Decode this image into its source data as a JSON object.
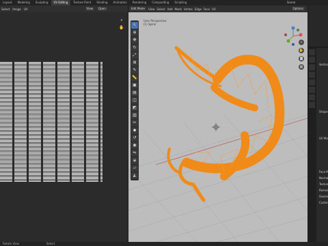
{
  "topbar": {
    "tabs": [
      "Layout",
      "Modeling",
      "Sculpting",
      "UV Editing",
      "Texture Paint",
      "Shading",
      "Animation",
      "Rendering",
      "Compositing",
      "Scripting"
    ],
    "active_tab": "UV Editing",
    "scene_label": "Scene"
  },
  "uv_editor": {
    "menu": [
      "Select",
      "Image",
      "UV"
    ],
    "view_label": "View",
    "open_label": "Open"
  },
  "viewport": {
    "mode": "Edit Mode",
    "menu": [
      "View",
      "Select",
      "Add",
      "Mesh",
      "Vertex",
      "Edge",
      "Face",
      "UV"
    ],
    "options_label": "Options",
    "info_line1": "User Perspective",
    "info_line2": "(1) Spiral",
    "mesh_color": "#f08a18"
  },
  "properties": {
    "rows": [
      "Vertices",
      "Shape Keys",
      "UV Maps",
      "Face Maps",
      "Normals",
      "Texture Space",
      "Remesh",
      "Geometry Data",
      "Custom Properties"
    ]
  },
  "statusbar": {
    "left": "Rotate View",
    "right": "Select"
  },
  "gizmo": {
    "x_color": "#e05050",
    "y_color": "#70a030",
    "z_color": "#4a7fd0"
  }
}
